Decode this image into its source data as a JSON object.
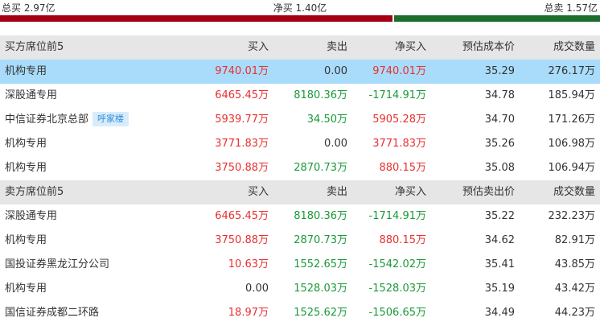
{
  "summary": {
    "total_buy": "总买 2.97亿",
    "net_buy": "净买 1.40亿",
    "total_sell": "总卖 1.57亿",
    "buy_fraction": 0.654,
    "colors": {
      "buy": "#a30014",
      "sell": "#1b6e2c"
    }
  },
  "buy_section": {
    "header": [
      "买方席位前5",
      "买入",
      "卖出",
      "净买入",
      "预估成本价",
      "成交数量"
    ],
    "rows": [
      {
        "name": "机构专用",
        "tag": "",
        "buy": "9740.01万",
        "sell": "0.00",
        "net": "9740.01万",
        "price": "35.29",
        "volume": "276.17万",
        "sell_color": "plain",
        "net_color": "red",
        "highlight": true
      },
      {
        "name": "深股通专用",
        "tag": "",
        "buy": "6465.45万",
        "sell": "8180.36万",
        "net": "-1714.91万",
        "price": "34.78",
        "volume": "185.94万",
        "sell_color": "green",
        "net_color": "green",
        "highlight": false
      },
      {
        "name": "中信证券北京总部",
        "tag": "呼家楼",
        "buy": "5939.77万",
        "sell": "34.50万",
        "net": "5905.28万",
        "price": "34.70",
        "volume": "171.26万",
        "sell_color": "green",
        "net_color": "red",
        "highlight": false
      },
      {
        "name": "机构专用",
        "tag": "",
        "buy": "3771.83万",
        "sell": "0.00",
        "net": "3771.83万",
        "price": "35.26",
        "volume": "106.98万",
        "sell_color": "plain",
        "net_color": "red",
        "highlight": false
      },
      {
        "name": "机构专用",
        "tag": "",
        "buy": "3750.88万",
        "sell": "2870.73万",
        "net": "880.15万",
        "price": "35.08",
        "volume": "106.94万",
        "sell_color": "green",
        "net_color": "red",
        "highlight": false
      }
    ]
  },
  "sell_section": {
    "header": [
      "卖方席位前5",
      "买入",
      "卖出",
      "净买入",
      "预估卖出价",
      "成交数量"
    ],
    "rows": [
      {
        "name": "深股通专用",
        "tag": "",
        "buy": "6465.45万",
        "sell": "8180.36万",
        "net": "-1714.91万",
        "price": "35.22",
        "volume": "232.23万",
        "buy_color": "red",
        "net_color": "green"
      },
      {
        "name": "机构专用",
        "tag": "",
        "buy": "3750.88万",
        "sell": "2870.73万",
        "net": "880.15万",
        "price": "34.62",
        "volume": "82.91万",
        "buy_color": "red",
        "net_color": "red"
      },
      {
        "name": "国投证券黑龙江分公司",
        "tag": "",
        "buy": "10.63万",
        "sell": "1552.65万",
        "net": "-1542.02万",
        "price": "35.41",
        "volume": "43.85万",
        "buy_color": "red",
        "net_color": "green"
      },
      {
        "name": "机构专用",
        "tag": "",
        "buy": "0.00",
        "sell": "1528.03万",
        "net": "-1528.03万",
        "price": "35.19",
        "volume": "43.42万",
        "buy_color": "plain",
        "net_color": "green"
      },
      {
        "name": "国信证券成都二环路",
        "tag": "",
        "buy": "18.97万",
        "sell": "1525.62万",
        "net": "-1506.65万",
        "price": "34.49",
        "volume": "44.23万",
        "buy_color": "red",
        "net_color": "green"
      }
    ]
  }
}
